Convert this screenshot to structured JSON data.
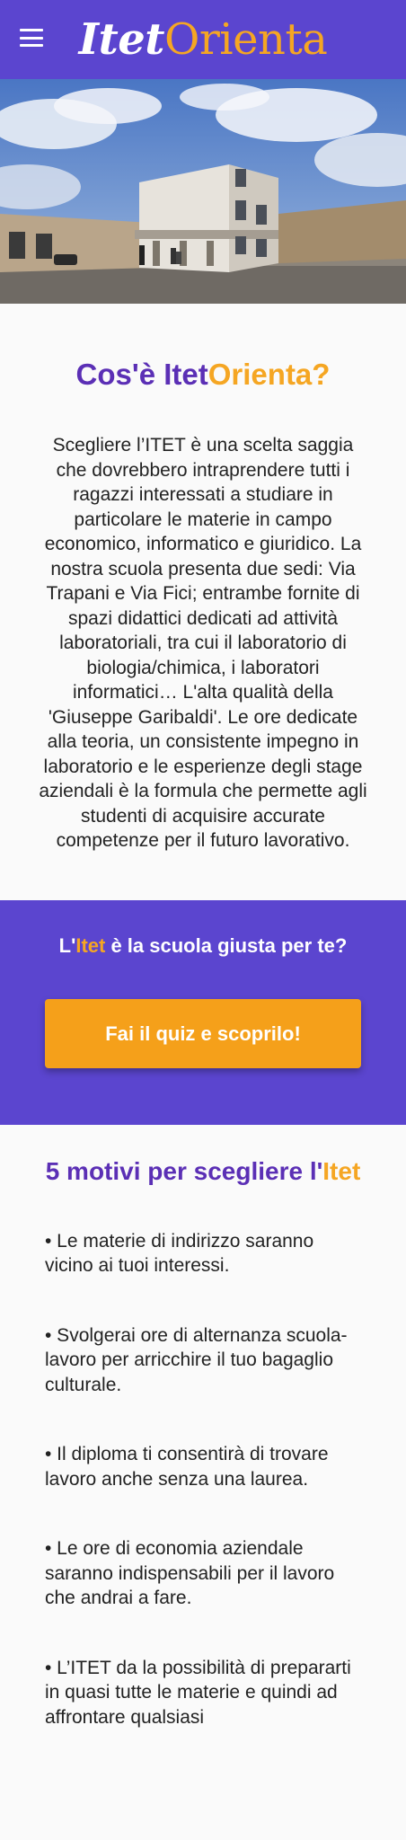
{
  "header": {
    "menu_icon": "hamburger-menu-icon",
    "logo_itet": "Itet",
    "logo_orienta": "Orienta",
    "colors": {
      "bar": "#5b45cf",
      "accent": "#f5a623"
    }
  },
  "hero": {
    "image": "school-building-photo"
  },
  "intro": {
    "title_main": "Cos'è Itet",
    "title_accent": "Orienta?",
    "body": "Scegliere l’ITET è una scelta saggia che dovrebbero intraprendere tutti i ragazzi interessati a studiare in particolare le materie in campo economico, informatico e giuridico. La nostra scuola presenta due sedi: Via Trapani e Via Fici; entrambe fornite di spazi didattici dedicati ad attività laboratoriali, tra cui il laboratorio di biologia/chimica, i laboratori informatici… L'alta qualità della 'Giuseppe Garibaldi'. Le ore dedicate alla teoria, un consistente impegno in laboratorio e le esperienze degli stage aziendali è la formula che permette agli studenti di acquisire accurate competenze per il futuro lavorativo."
  },
  "cta": {
    "question_pre": "L'",
    "question_accent": "Itet",
    "question_post": " è la scuola giusta per te?",
    "button_label": "Fai il quiz e scoprilo!"
  },
  "reasons": {
    "title_main": "5 motivi per scegliere l'",
    "title_accent": "Itet",
    "items": [
      "• Le materie di indirizzo saranno vicino ai tuoi interessi.",
      "• Svolgerai ore di alternanza scuola-lavoro per arricchire il tuo bagaglio culturale.",
      "• Il diploma ti consentirà di trovare lavoro anche senza una laurea.",
      "• Le ore di economia aziendale saranno indispensabili per il lavoro che andrai a fare.",
      "• L’ITET da la possibilità di prepararti in quasi tutte le materie e quindi ad affrontare qualsiasi"
    ]
  }
}
